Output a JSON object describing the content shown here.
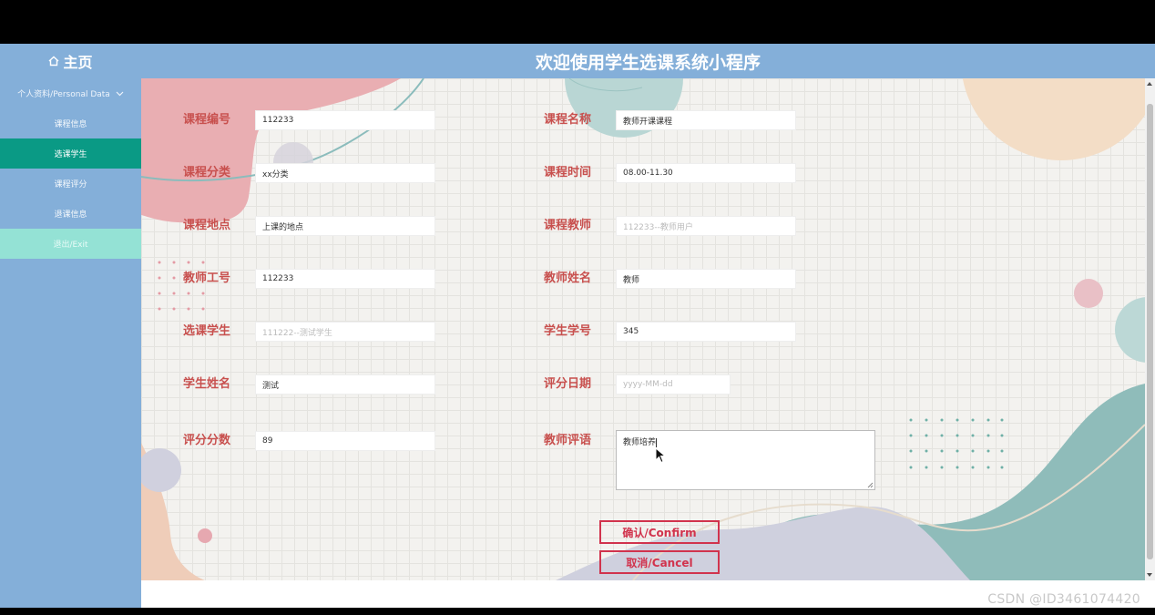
{
  "header": {
    "home_label": "主页",
    "app_title": "欢迎使用学生选课系统小程序"
  },
  "sidebar": {
    "menu_header": "个人资料/Personal Data",
    "items": [
      {
        "label": "课程信息"
      },
      {
        "label": "选课学生"
      },
      {
        "label": "课程评分"
      },
      {
        "label": "退课信息"
      },
      {
        "label": "退出/Exit"
      }
    ]
  },
  "form": {
    "course_no": {
      "label": "课程编号",
      "value": "112233"
    },
    "course_name": {
      "label": "课程名称",
      "value": "教师开课课程"
    },
    "course_category": {
      "label": "课程分类",
      "value": "xx分类"
    },
    "course_time": {
      "label": "课程时间",
      "value": "08.00-11.30"
    },
    "course_location": {
      "label": "课程地点",
      "value": "上课的地点"
    },
    "course_teacher": {
      "label": "课程教师",
      "placeholder": "112233--教师用户"
    },
    "teacher_id": {
      "label": "教师工号",
      "value": "112233"
    },
    "teacher_name": {
      "label": "教师姓名",
      "value": "教师"
    },
    "selected_student": {
      "label": "选课学生",
      "placeholder": "111222--测试学生"
    },
    "student_id": {
      "label": "学生学号",
      "value": "345"
    },
    "student_name": {
      "label": "学生姓名",
      "value": "测试"
    },
    "rating_date": {
      "label": "评分日期",
      "placeholder": "yyyy-MM-dd"
    },
    "score": {
      "label": "评分分数",
      "value": "89"
    },
    "teacher_comment": {
      "label": "教师评语",
      "value": "教师培养"
    }
  },
  "buttons": {
    "confirm": "确认/Confirm",
    "cancel": "取消/Cancel"
  },
  "watermark": "CSDN @ID3461074420",
  "colors": {
    "header_bg": "#84afd9",
    "active_item": "#0a9a85",
    "exit_item": "#94e2d5",
    "label_red": "#c8504e",
    "button_red": "#d1334d"
  }
}
